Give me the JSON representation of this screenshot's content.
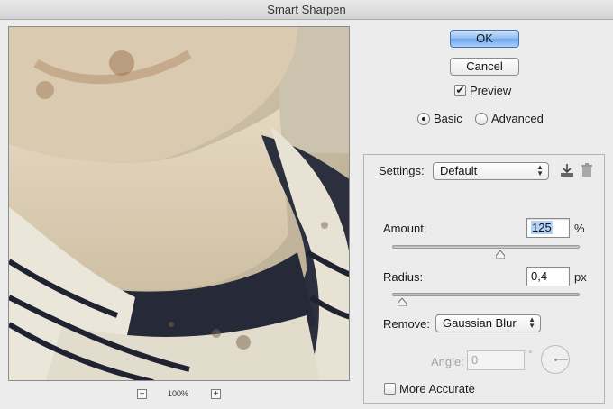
{
  "window": {
    "title": "Smart Sharpen"
  },
  "preview": {
    "zoom_level": "100%",
    "zoom_out_glyph": "−",
    "zoom_in_glyph": "+"
  },
  "buttons": {
    "ok_label": "OK",
    "cancel_label": "Cancel"
  },
  "preview_toggle": {
    "label": "Preview",
    "checked": true,
    "check_glyph": "✔"
  },
  "mode": {
    "basic_label": "Basic",
    "advanced_label": "Advanced",
    "selected": "Basic"
  },
  "settings": {
    "label": "Settings:",
    "value": "Default",
    "save_icon": "save-preset-icon",
    "delete_icon": "trash-icon"
  },
  "amount": {
    "label": "Amount:",
    "value": "125",
    "unit": "%",
    "slider_fraction": 0.58
  },
  "radius": {
    "label": "Radius:",
    "value": "0,4",
    "unit": "px",
    "slider_fraction": 0.03
  },
  "remove": {
    "label": "Remove:",
    "value": "Gaussian Blur"
  },
  "angle": {
    "label": "Angle:",
    "value": "0",
    "unit": "°"
  },
  "more_accurate": {
    "label": "More Accurate",
    "checked": false
  },
  "colors": {
    "accent": "#6ea7ef",
    "window_bg": "#ececec"
  }
}
